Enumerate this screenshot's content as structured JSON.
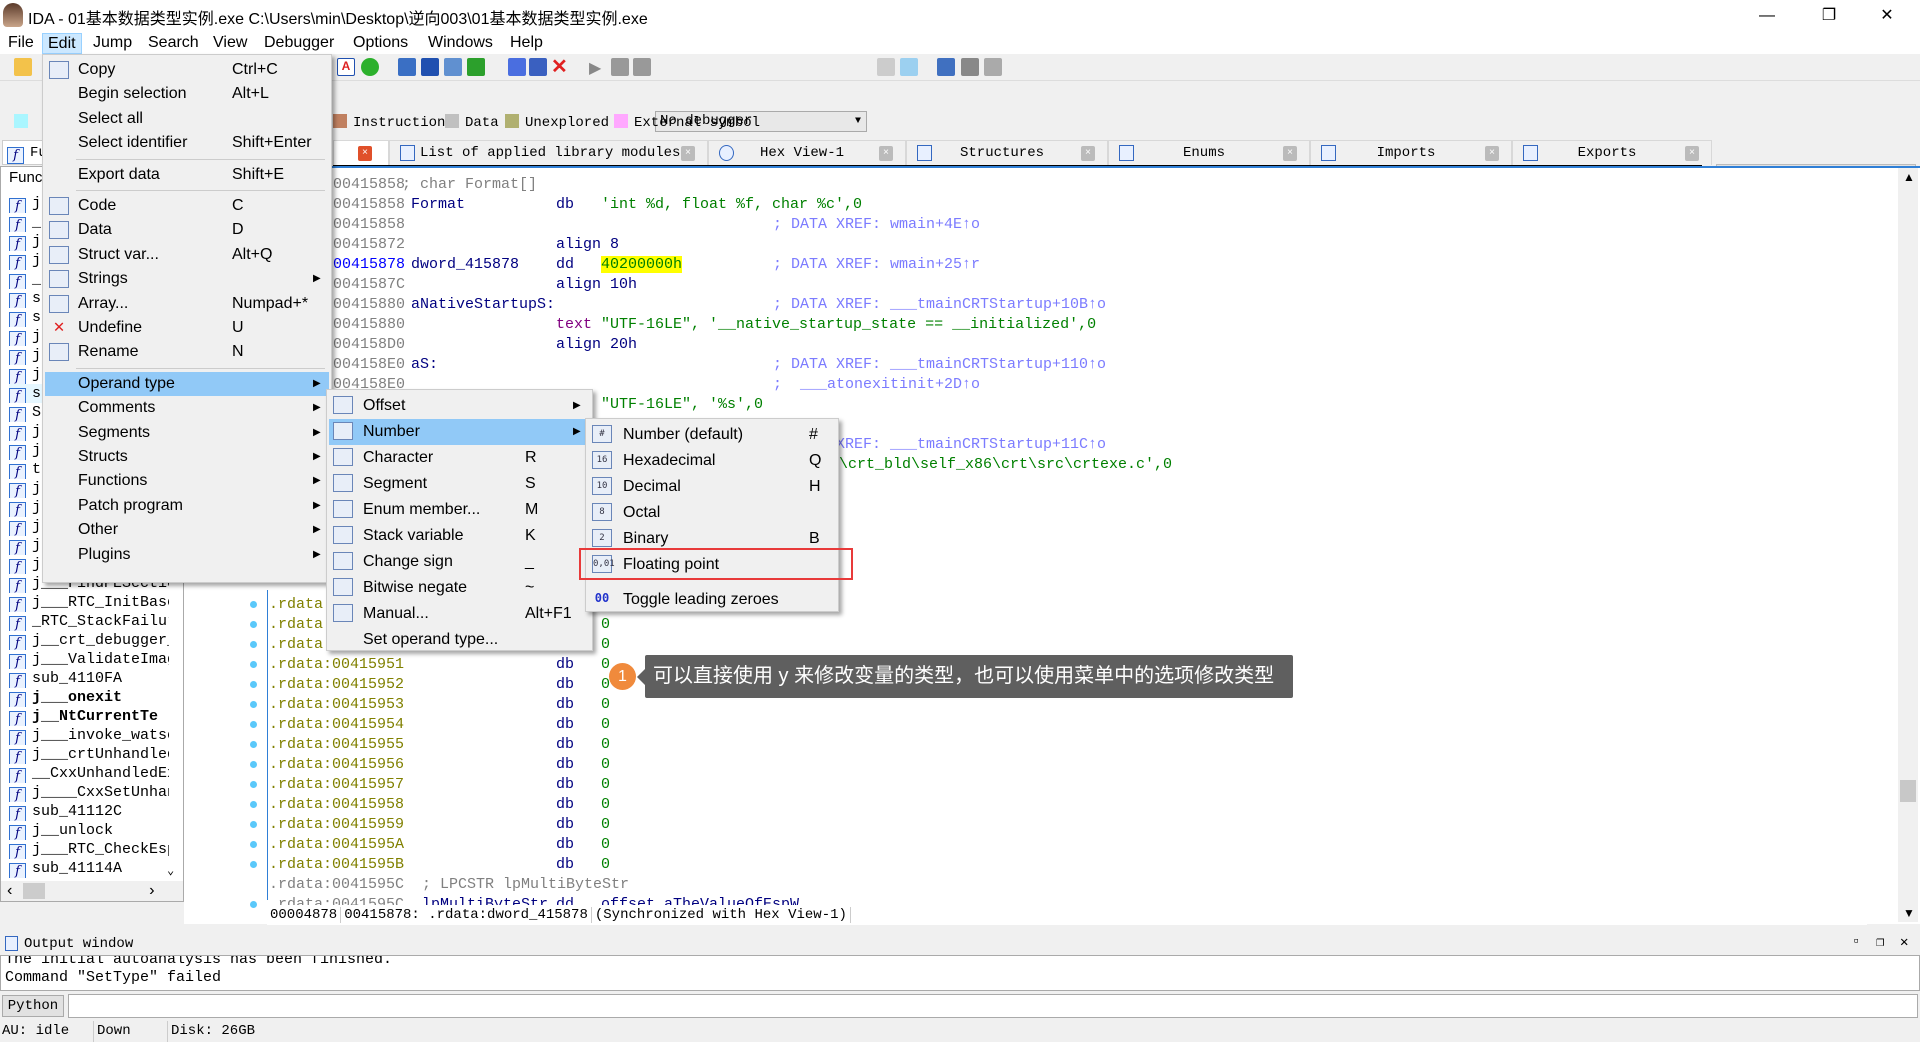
{
  "window": {
    "title": "IDA - 01基本数据类型实例.exe C:\\Users\\min\\Desktop\\逆向003\\01基本数据类型实例.exe",
    "minimize": "—",
    "restore": "❐",
    "close": "✕"
  },
  "menubar": [
    "File",
    "Edit",
    "Jump",
    "Search",
    "View",
    "Debugger",
    "Options",
    "Windows",
    "Help"
  ],
  "toolbar": {
    "debugger_select": "No debugger"
  },
  "legend": [
    {
      "label": "Instruction",
      "color": "#c08060"
    },
    {
      "label": "Data",
      "color": "#c0c0c0"
    },
    {
      "label": "Unexplored",
      "color": "#b0b070"
    },
    {
      "label": "External symbol",
      "color": "#ffa8ff"
    }
  ],
  "left_tab": "Fu",
  "tabs": [
    {
      "label": ""
    },
    {
      "label": "List of applied library modules"
    },
    {
      "label": "Hex View-1"
    },
    {
      "label": "Structures"
    },
    {
      "label": "Enums"
    },
    {
      "label": "Imports"
    },
    {
      "label": "Exports"
    }
  ],
  "functions": {
    "header": "Func",
    "items": [
      {
        "name": "j"
      },
      {
        "name": "_"
      },
      {
        "name": "j"
      },
      {
        "name": "j"
      },
      {
        "name": "_"
      },
      {
        "name": "s"
      },
      {
        "name": "s"
      },
      {
        "name": "j"
      },
      {
        "name": "j"
      },
      {
        "name": "j"
      },
      {
        "name": "s",
        "selected": true
      },
      {
        "name": "S"
      },
      {
        "name": "j"
      },
      {
        "name": "j"
      },
      {
        "name": "t"
      },
      {
        "name": "j"
      },
      {
        "name": "j"
      },
      {
        "name": "j"
      },
      {
        "name": "j"
      },
      {
        "name": "j"
      },
      {
        "name": "j___FindPESectio"
      },
      {
        "name": "j___RTC_InitBase"
      },
      {
        "name": "_RTC_StackFailur"
      },
      {
        "name": "j__crt_debugger_"
      },
      {
        "name": "j___ValidateImag"
      },
      {
        "name": "sub_4110FA"
      },
      {
        "name": "j___onexit",
        "bold": true
      },
      {
        "name": "j__NtCurrentTe",
        "bold": true
      },
      {
        "name": "j___invoke_watso"
      },
      {
        "name": "j___crtUnhandled"
      },
      {
        "name": "__CxxUnhandledEx"
      },
      {
        "name": "j____CxxSetUnhan"
      },
      {
        "name": "sub_41112C"
      },
      {
        "name": "j__unlock"
      },
      {
        "name": "j___RTC_CheckEsp"
      },
      {
        "name": "sub_41114A"
      }
    ]
  },
  "listing": [
    {
      "addr": "00415858",
      "comment_line": "; char Format[]"
    },
    {
      "addr": "00415858",
      "label": "Format",
      "mnem": "db",
      "operand": "'int %d, float %f, char %c',0"
    },
    {
      "addr": "00415858",
      "comment": "; DATA XREF: wmain+4E↑o"
    },
    {
      "addr": "00415872",
      "mnem": "align",
      "operand_plain": "8"
    },
    {
      "addr": "00415878",
      "current": true,
      "label": "dword_415878",
      "mnem": "dd",
      "operand_highlight": "40200000h",
      "comment": "; DATA XREF: wmain+25↑r"
    },
    {
      "addr": "0041587C",
      "mnem": "align",
      "operand_plain": "10h"
    },
    {
      "addr": "00415880",
      "label": "aNativeStartupS:",
      "comment": "; DATA XREF: ___tmainCRTStartup+10B↑o"
    },
    {
      "addr": "00415880",
      "mnem": "text",
      "operand": "\"UTF-16LE\", '__native_startup_state == __initialized',0"
    },
    {
      "addr": "004158D0",
      "mnem": "align",
      "operand_plain": "20h"
    },
    {
      "addr": "004158E0",
      "label": "aS:",
      "comment": "; DATA XREF: ___tmainCRTStartup+110↑o"
    },
    {
      "addr": "004158E0",
      "comment": ";  ___atonexitinit+2D↑o"
    },
    {
      "mnem": "text",
      "operand": "\"UTF-16LE\", '%s',0"
    },
    {
      "mnem": "align",
      "operand_plain": "4"
    },
    {
      "comment": "; DATA XREF: ___tmainCRTStartup+11C↑o"
    },
    {
      "operand_tail": "\\crt_bld\\self_x86\\crt\\src\\crtexe.c',0"
    },
    {},
    {},
    {},
    {},
    {},
    {},
    {
      "rdata": ".rdata",
      "dot": true,
      "mnem": "db",
      "operand": "0"
    },
    {
      "rdata": ".rdata",
      "dot": true,
      "mnem": "db",
      "operand": "0"
    },
    {
      "rdata": ".rdata",
      "dot": true,
      "mnem": "db",
      "operand": "0"
    },
    {
      "rdata": ".rdata:00415951",
      "dot": true,
      "mnem": "db",
      "operand": "0"
    },
    {
      "rdata": ".rdata:00415952",
      "dot": true,
      "mnem": "db",
      "operand": "0"
    },
    {
      "rdata": ".rdata:00415953",
      "dot": true,
      "mnem": "db",
      "operand": "0"
    },
    {
      "rdata": ".rdata:00415954",
      "dot": true,
      "mnem": "db",
      "operand": "0"
    },
    {
      "rdata": ".rdata:00415955",
      "dot": true,
      "mnem": "db",
      "operand": "0"
    },
    {
      "rdata": ".rdata:00415956",
      "dot": true,
      "mnem": "db",
      "operand": "0"
    },
    {
      "rdata": ".rdata:00415957",
      "dot": true,
      "mnem": "db",
      "operand": "0"
    },
    {
      "rdata": ".rdata:00415958",
      "dot": true,
      "mnem": "db",
      "operand": "0"
    },
    {
      "rdata": ".rdata:00415959",
      "dot": true,
      "mnem": "db",
      "operand": "0"
    },
    {
      "rdata": ".rdata:0041595A",
      "dot": true,
      "mnem": "db",
      "operand": "0"
    },
    {
      "rdata": ".rdata:0041595B",
      "dot": true,
      "mnem": "db",
      "operand": "0"
    },
    {
      "rdata_gray": ".rdata:0041595C",
      "comment_inline": "; LPCSTR lpMultiByteStr"
    },
    {
      "rdata_gray": ".rdata:0041595C",
      "dot": true,
      "label_inline": "lpMultiByteStr",
      "mnem": "dd",
      "operand_label": "offset aTheValueOfEspW"
    }
  ],
  "listing_status": [
    "00004878",
    "00415878: .rdata:dword_415878",
    "(Synchronized with Hex View-1)"
  ],
  "output": {
    "title": "Output window",
    "lines": [
      "The initial autoanalysis has been finished.",
      "Command \"SetType\" failed"
    ],
    "python_button": "Python"
  },
  "status_bar": [
    "AU:  idle",
    "Down",
    "Disk: 26GB"
  ],
  "edit_menu": [
    {
      "label": "Copy",
      "shortcut": "Ctrl+C",
      "icon": "copy-icon"
    },
    {
      "label": "Begin selection",
      "shortcut": "Alt+L"
    },
    {
      "label": "Select all",
      "shortcut": ""
    },
    {
      "label": "Select identifier",
      "shortcut": "Shift+Enter"
    },
    {
      "sep": true
    },
    {
      "label": "Export data",
      "shortcut": "Shift+E"
    },
    {
      "sep": true
    },
    {
      "label": "Code",
      "shortcut": "C",
      "icon": "code-icon"
    },
    {
      "label": "Data",
      "shortcut": "D",
      "icon": "data-icon"
    },
    {
      "label": "Struct var...",
      "shortcut": "Alt+Q",
      "icon": "struct-var-icon"
    },
    {
      "label": "Strings",
      "submenu": true,
      "icon": "strings-icon"
    },
    {
      "label": "Array...",
      "shortcut": "Numpad+*",
      "icon": "array-icon"
    },
    {
      "label": "Undefine",
      "shortcut": "U",
      "icon": "undefine-icon"
    },
    {
      "label": "Rename",
      "shortcut": "N",
      "icon": "rename-icon"
    },
    {
      "sep": true
    },
    {
      "label": "Operand type",
      "submenu": true,
      "active": true
    },
    {
      "label": "Comments",
      "submenu": true
    },
    {
      "label": "Segments",
      "submenu": true
    },
    {
      "label": "Structs",
      "submenu": true
    },
    {
      "label": "Functions",
      "submenu": true
    },
    {
      "label": "Patch program",
      "submenu": true
    },
    {
      "label": "Other",
      "submenu": true
    },
    {
      "label": "Plugins",
      "submenu": true
    }
  ],
  "operand_menu": [
    {
      "label": "Offset",
      "submenu": true,
      "icon": "offset-icon"
    },
    {
      "label": "Number",
      "submenu": true,
      "active": true,
      "icon": "number-icon"
    },
    {
      "label": "Character",
      "shortcut": "R",
      "icon": "character-icon"
    },
    {
      "label": "Segment",
      "shortcut": "S",
      "icon": "segment-icon"
    },
    {
      "label": "Enum member...",
      "shortcut": "M",
      "icon": "enum-member-icon"
    },
    {
      "label": "Stack variable",
      "shortcut": "K",
      "icon": "stack-variable-icon"
    },
    {
      "label": "Change sign",
      "shortcut": "_",
      "icon": "change-sign-icon"
    },
    {
      "label": "Bitwise negate",
      "shortcut": "~",
      "icon": "bitwise-negate-icon"
    },
    {
      "label": "Manual...",
      "shortcut": "Alt+F1",
      "icon": "manual-icon"
    },
    {
      "label": "Set operand type...",
      "shortcut": ""
    }
  ],
  "number_menu": [
    {
      "label": "Number (default)",
      "shortcut": "#",
      "icon": "number-default-icon",
      "glyph": "#"
    },
    {
      "label": "Hexadecimal",
      "shortcut": "Q",
      "icon": "hexadecimal-icon",
      "glyph": "16"
    },
    {
      "label": "Decimal",
      "shortcut": "H",
      "icon": "decimal-icon",
      "glyph": "10"
    },
    {
      "label": "Octal",
      "shortcut": "",
      "icon": "octal-icon",
      "glyph": "8"
    },
    {
      "label": "Binary",
      "shortcut": "B",
      "icon": "binary-icon",
      "glyph": "2"
    },
    {
      "label": "Floating point",
      "shortcut": "",
      "icon": "floating-point-icon",
      "glyph": "0,01",
      "highlighted_box": true
    },
    {
      "label": "Toggle leading zeroes",
      "shortcut": "",
      "icon": "toggle-zeroes-icon",
      "glyph": "00"
    }
  ],
  "annotation": {
    "badge": "1",
    "text": "可以直接使用 y 来修改变量的类型，也可以使用菜单中的选项修改类型",
    "badge_color": "#f08a3c",
    "highlight_color": "#e83a3a"
  }
}
